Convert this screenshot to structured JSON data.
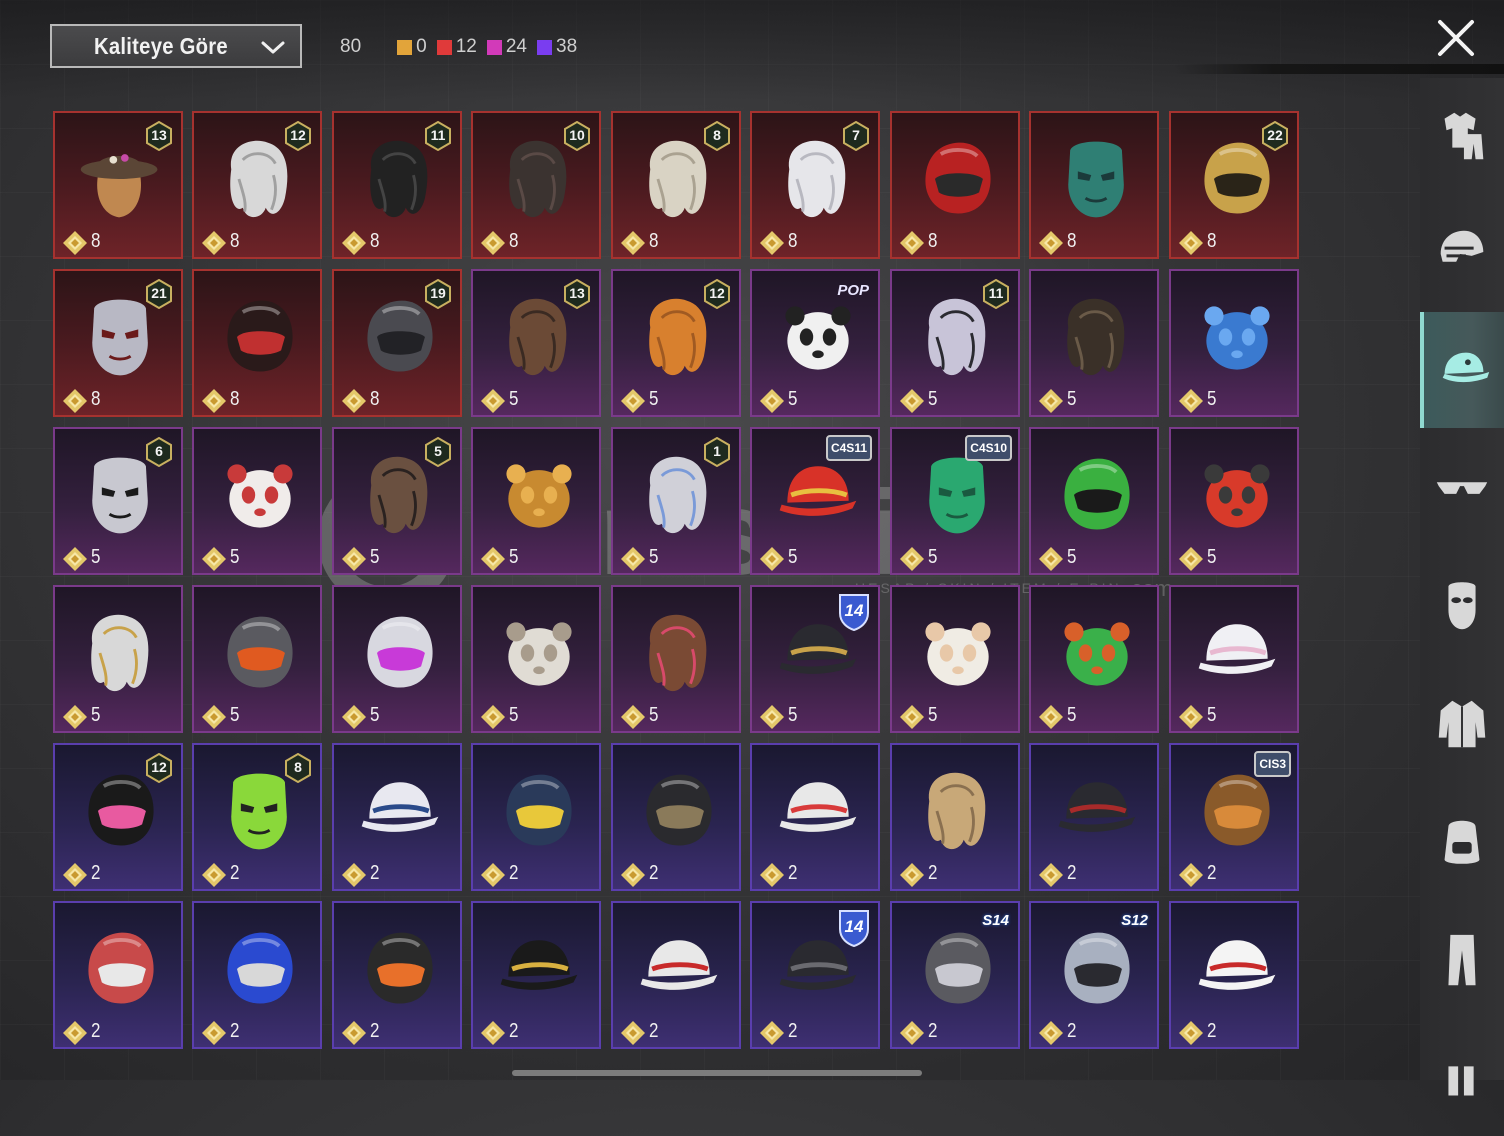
{
  "toolbar": {
    "sort_label": "Kaliteye Göre",
    "total_count": "80",
    "quality_counts": [
      {
        "value": "0",
        "color": "#e2a43a"
      },
      {
        "value": "12",
        "color": "#e03a3a"
      },
      {
        "value": "24",
        "color": "#d23ab9"
      },
      {
        "value": "38",
        "color": "#7a3df0"
      }
    ]
  },
  "sidebar": {
    "categories": [
      {
        "icon": "outfit-icon",
        "active": false
      },
      {
        "icon": "helmet-icon",
        "active": false
      },
      {
        "icon": "cap-icon",
        "active": true
      },
      {
        "icon": "glasses-icon",
        "active": false
      },
      {
        "icon": "mask-icon",
        "active": false
      },
      {
        "icon": "jacket-icon",
        "active": false
      },
      {
        "icon": "backpack-icon",
        "active": false
      },
      {
        "icon": "pants-icon",
        "active": false
      },
      {
        "icon": "shoes-icon",
        "active": false
      }
    ]
  },
  "watermark": {
    "brand": "itemsatis",
    "tagline": "HESAP / SKIN / ITEM / E-PIN",
    "domain": ".com"
  },
  "items": [
    {
      "name": "flower-brim-hat-with-hair",
      "quality": "red",
      "price": "8",
      "level": "13",
      "art": "hat-hair",
      "c1": "#5b4636",
      "c2": "#c08850"
    },
    {
      "name": "white-hair-with-bow",
      "quality": "red",
      "price": "8",
      "level": "12",
      "art": "hair",
      "c1": "#d8d8d8",
      "c2": "#a0a0a0"
    },
    {
      "name": "black-short-hair",
      "quality": "red",
      "price": "8",
      "level": "11",
      "art": "hair",
      "c1": "#222222",
      "c2": "#444444"
    },
    {
      "name": "dark-long-hair",
      "quality": "red",
      "price": "8",
      "level": "10",
      "art": "hair",
      "c1": "#3b3330",
      "c2": "#5a4a46"
    },
    {
      "name": "blonde-bob-hair",
      "quality": "red",
      "price": "8",
      "level": "8",
      "art": "hair",
      "c1": "#d9d3c4",
      "c2": "#aaa291"
    },
    {
      "name": "white-ponytail-hair",
      "quality": "red",
      "price": "8",
      "level": "7",
      "art": "hair",
      "c1": "#e6e6ea",
      "c2": "#b8b8c0"
    },
    {
      "name": "red-full-helmet",
      "quality": "red",
      "price": "8",
      "level": "",
      "art": "helmet",
      "c1": "#b82222",
      "c2": "#2a2a2a"
    },
    {
      "name": "teal-dragon-mask",
      "quality": "red",
      "price": "8",
      "level": "",
      "art": "mask",
      "c1": "#2f7f74",
      "c2": "#1b3a3a"
    },
    {
      "name": "gold-pharaoh-headdress",
      "quality": "red",
      "price": "8",
      "level": "22",
      "art": "helmet",
      "c1": "#c8a24a",
      "c2": "#2a2418"
    },
    {
      "name": "silver-oni-mask",
      "quality": "red",
      "price": "8",
      "level": "21",
      "art": "mask",
      "c1": "#b8b8c4",
      "c2": "#6b1a1a"
    },
    {
      "name": "red-black-ninja-helmet",
      "quality": "red",
      "price": "8",
      "level": "",
      "art": "helmet",
      "c1": "#2a1a1a",
      "c2": "#c03030"
    },
    {
      "name": "grey-visor-helmet",
      "quality": "red",
      "price": "8",
      "level": "19",
      "art": "helmet",
      "c1": "#4a4a50",
      "c2": "#222226"
    },
    {
      "name": "goggles-brown-hair",
      "quality": "purple",
      "price": "5",
      "level": "13",
      "art": "hair",
      "c1": "#6b4a36",
      "c2": "#3a2a22"
    },
    {
      "name": "orange-pigtail-hair",
      "quality": "purple",
      "price": "5",
      "level": "12",
      "art": "hair",
      "c1": "#d8802e",
      "c2": "#a05a22"
    },
    {
      "name": "panda-head",
      "quality": "purple",
      "price": "5",
      "level": "",
      "art": "animal",
      "c1": "#f0f0f0",
      "c2": "#222222",
      "tag": "POP",
      "tagstyle": "plain"
    },
    {
      "name": "flower-band-white-hair",
      "quality": "purple",
      "price": "5",
      "level": "11",
      "art": "hair",
      "c1": "#c8c4d8",
      "c2": "#2a2a30"
    },
    {
      "name": "dark-feather-hairpin",
      "quality": "purple",
      "price": "5",
      "level": "",
      "art": "hair",
      "c1": "#3a3028",
      "c2": "#6a5a48"
    },
    {
      "name": "blue-bird-hat",
      "quality": "purple",
      "price": "5",
      "level": "",
      "art": "animal",
      "c1": "#3a7ad0",
      "c2": "#6aa8f0"
    },
    {
      "name": "silver-knight-mask",
      "quality": "purple",
      "price": "5",
      "level": "6",
      "art": "mask",
      "c1": "#c8c8d0",
      "c2": "#1a1a1a"
    },
    {
      "name": "white-cat-hat",
      "quality": "purple",
      "price": "5",
      "level": "",
      "art": "animal",
      "c1": "#f0ecea",
      "c2": "#c83a3a"
    },
    {
      "name": "cat-ears-brown-hair",
      "quality": "purple",
      "price": "5",
      "level": "5",
      "art": "hair",
      "c1": "#6a5040",
      "c2": "#2a2220"
    },
    {
      "name": "potato-head",
      "quality": "purple",
      "price": "5",
      "level": "",
      "art": "animal",
      "c1": "#c88a30",
      "c2": "#e8b050"
    },
    {
      "name": "silver-bun-hair",
      "quality": "purple",
      "price": "5",
      "level": "1",
      "art": "hair",
      "c1": "#d0d0d8",
      "c2": "#7a9ad8"
    },
    {
      "name": "red-racing-cap",
      "quality": "purple",
      "price": "5",
      "level": "",
      "art": "cap",
      "c1": "#d83228",
      "c2": "#e8c040",
      "tag": "C4S11",
      "tagstyle": "box"
    },
    {
      "name": "green-dragon-helmet",
      "quality": "purple",
      "price": "5",
      "level": "",
      "art": "mask",
      "c1": "#2aa870",
      "c2": "#1a5a40",
      "tag": "C4S10",
      "tagstyle": "box"
    },
    {
      "name": "green-camo-helmet",
      "quality": "purple",
      "price": "5",
      "level": "",
      "art": "helmet",
      "c1": "#3ab040",
      "c2": "#1a1a1a"
    },
    {
      "name": "red-crab-headphones",
      "quality": "purple",
      "price": "5",
      "level": "",
      "art": "animal",
      "c1": "#d83a2a",
      "c2": "#3a3a3a"
    },
    {
      "name": "gold-crown-white-hair",
      "quality": "purple",
      "price": "5",
      "level": "",
      "art": "hair",
      "c1": "#d8d8d8",
      "c2": "#c8a24a"
    },
    {
      "name": "grey-orange-moto-helmet",
      "quality": "purple",
      "price": "5",
      "level": "",
      "art": "helmet",
      "c1": "#5a5a60",
      "c2": "#e05a20"
    },
    {
      "name": "pink-visor-helmet",
      "quality": "purple",
      "price": "5",
      "level": "",
      "art": "helmet",
      "c1": "#d8d8e0",
      "c2": "#c83ad8"
    },
    {
      "name": "white-eagle-hat",
      "quality": "purple",
      "price": "5",
      "level": "",
      "art": "animal",
      "c1": "#e0dcd4",
      "c2": "#a89c8c"
    },
    {
      "name": "pink-headband-hair",
      "quality": "purple",
      "price": "5",
      "level": "",
      "art": "hair",
      "c1": "#7a4a34",
      "c2": "#d84a6a"
    },
    {
      "name": "officer-cap",
      "quality": "purple",
      "price": "5",
      "level": "",
      "art": "cap",
      "c1": "#2a2a30",
      "c2": "#c8a24a",
      "tag": "14",
      "tagstyle": "shield"
    },
    {
      "name": "sheep-head",
      "quality": "purple",
      "price": "5",
      "level": "",
      "art": "animal",
      "c1": "#f0ece4",
      "c2": "#e8c8a8"
    },
    {
      "name": "frog-aviator-hat",
      "quality": "purple",
      "price": "5",
      "level": "",
      "art": "animal",
      "c1": "#3ab04a",
      "c2": "#d8602a"
    },
    {
      "name": "white-sun-hat",
      "quality": "purple",
      "price": "5",
      "level": "",
      "art": "cap",
      "c1": "#f0f0f4",
      "c2": "#e8b8d0"
    },
    {
      "name": "bunny-ear-helmet",
      "quality": "violet",
      "price": "2",
      "level": "12",
      "art": "helmet",
      "c1": "#1a1a1a",
      "c2": "#e85aa0"
    },
    {
      "name": "green-skull-hood",
      "quality": "violet",
      "price": "2",
      "level": "8",
      "art": "mask",
      "c1": "#8ad83a",
      "c2": "#222222"
    },
    {
      "name": "white-blue-cap",
      "quality": "violet",
      "price": "2",
      "level": "",
      "art": "cap",
      "c1": "#e8e8f0",
      "c2": "#2a4a8a"
    },
    {
      "name": "gas-mask-helmet",
      "quality": "violet",
      "price": "2",
      "level": "",
      "art": "helmet",
      "c1": "#2a3a5a",
      "c2": "#e8c83a"
    },
    {
      "name": "black-hockey-helmet",
      "quality": "violet",
      "price": "2",
      "level": "",
      "art": "helmet",
      "c1": "#2a2a2e",
      "c2": "#8a7a5a"
    },
    {
      "name": "red-white-cap",
      "quality": "violet",
      "price": "2",
      "level": "",
      "art": "cap",
      "c1": "#e8e8e8",
      "c2": "#d83a3a"
    },
    {
      "name": "wavy-blonde-hair",
      "quality": "violet",
      "price": "2",
      "level": "",
      "art": "hair",
      "c1": "#c8a878",
      "c2": "#8a7050"
    },
    {
      "name": "bucket-hat-red-hair",
      "quality": "violet",
      "price": "2",
      "level": "",
      "art": "cap",
      "c1": "#2a2a30",
      "c2": "#a82a2a"
    },
    {
      "name": "barrel-steampunk-hat",
      "quality": "violet",
      "price": "2",
      "level": "",
      "art": "helmet",
      "c1": "#8a5a2a",
      "c2": "#d88a3a",
      "tag": "CIS3",
      "tagstyle": "box"
    },
    {
      "name": "red-football-helmet",
      "quality": "violet",
      "price": "2",
      "level": "",
      "art": "helmet",
      "c1": "#c84a4a",
      "c2": "#e8e8e8"
    },
    {
      "name": "blue-cricket-helmet",
      "quality": "violet",
      "price": "2",
      "level": "",
      "art": "helmet",
      "c1": "#2a4ad0",
      "c2": "#d8d8d8"
    },
    {
      "name": "ponytail-tech-helmet",
      "quality": "violet",
      "price": "2",
      "level": "",
      "art": "helmet",
      "c1": "#2a2a2a",
      "c2": "#e8702a"
    },
    {
      "name": "black-fedora",
      "quality": "violet",
      "price": "2",
      "level": "",
      "art": "cap",
      "c1": "#1a1a1a",
      "c2": "#d8b040"
    },
    {
      "name": "red-bandana-hat",
      "quality": "violet",
      "price": "2",
      "level": "",
      "art": "cap",
      "c1": "#e8e8e8",
      "c2": "#c82a2a"
    },
    {
      "name": "studded-officer-cap",
      "quality": "violet",
      "price": "2",
      "level": "",
      "art": "cap",
      "c1": "#2a2a30",
      "c2": "#6a6a70",
      "tag": "14",
      "tagstyle": "shield"
    },
    {
      "name": "chainmail-knight-helmet",
      "quality": "violet",
      "price": "2",
      "level": "",
      "art": "helmet",
      "c1": "#5a5a60",
      "c2": "#c8c8d0",
      "tag": "S14",
      "tagstyle": "season"
    },
    {
      "name": "silver-astronaut-helmet",
      "quality": "violet",
      "price": "2",
      "level": "",
      "art": "helmet",
      "c1": "#a8b0c0",
      "c2": "#2a2a30",
      "tag": "S12",
      "tagstyle": "season"
    },
    {
      "name": "white-feather-hat",
      "quality": "violet",
      "price": "2",
      "level": "",
      "art": "cap",
      "c1": "#f4f4f4",
      "c2": "#c82a2a"
    }
  ]
}
